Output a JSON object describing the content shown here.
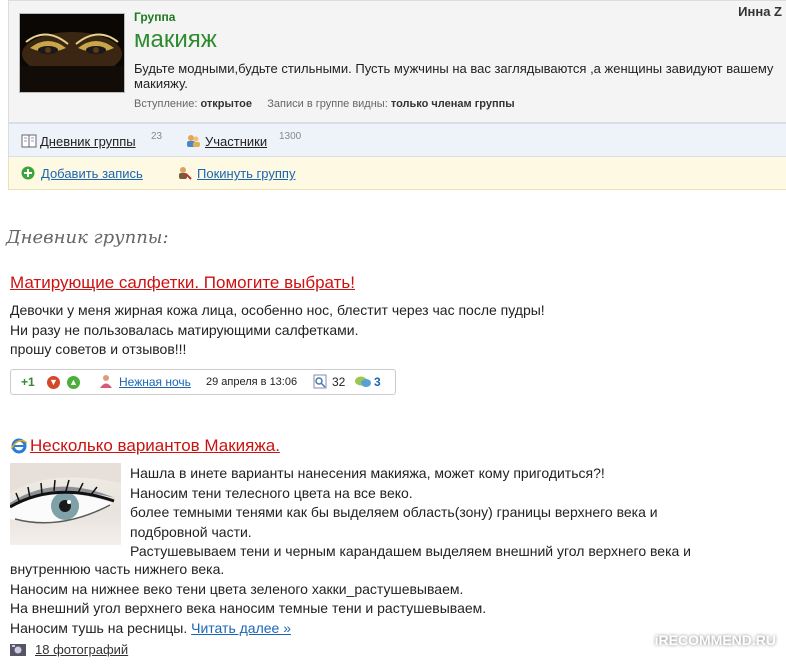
{
  "group": {
    "kicker": "Группа",
    "title": "макияж",
    "user": "Инна Z",
    "description": "Будьте модными,будьте стильными. Пусть мужчины на вас заглядываются ,а женщины завидуют вашему макияжу.",
    "entry_label": "Вступление:",
    "entry_value": "открытое",
    "visibility_label": "Записи в группе видны:",
    "visibility_value": "только членам группы"
  },
  "nav": {
    "diary_label": "Дневник группы",
    "diary_count": "23",
    "members_label": "Участники",
    "members_count": "1300"
  },
  "actions": {
    "add_label": "Добавить запись",
    "leave_label": "Покинуть группу"
  },
  "section_title": "Дневник группы:",
  "post1": {
    "title": "Матирующие салфетки. Помогите выбрать!",
    "lines": [
      "Девочки у меня жирная кожа лица, особенно нос, блестит через час после пудры!",
      "Ни разу не пользовалась матирующими салфетками.",
      "прошу советов и отзывов!!!"
    ],
    "rating": "+1",
    "author": "Нежная ночь",
    "date": "29 апреля в 13:06",
    "views": "32",
    "comments": "3"
  },
  "post2": {
    "title": "Несколько вариантов Макияжа.",
    "lines": [
      "Нашла в инете варианты нанесения макияжа, может кому пригодиться?!",
      "Наносим тени телесного цвета на все веко.",
      "более темными тенями как бы выделяем область(зону) границы верхнего века и",
      "подбровной части.",
      "Растушевываем тени и черным карандашем выделяем внешний угол верхнего века и",
      "внутреннюю часть нижнего века.",
      "Наносим на нижнее веко тени цвета зеленого хакки_растушевываем.",
      "На внешний угол верхнего века наносим темные тени и растушевываем.",
      "Наносим тушь на ресницы."
    ],
    "read_more": "Читать далее »",
    "photos": "18 фотографий"
  },
  "watermark": "iRECOMMEND.RU",
  "colors": {
    "title_red": "#cc1111",
    "link_blue": "#1a66b3",
    "group_green": "#2e8b2e"
  }
}
